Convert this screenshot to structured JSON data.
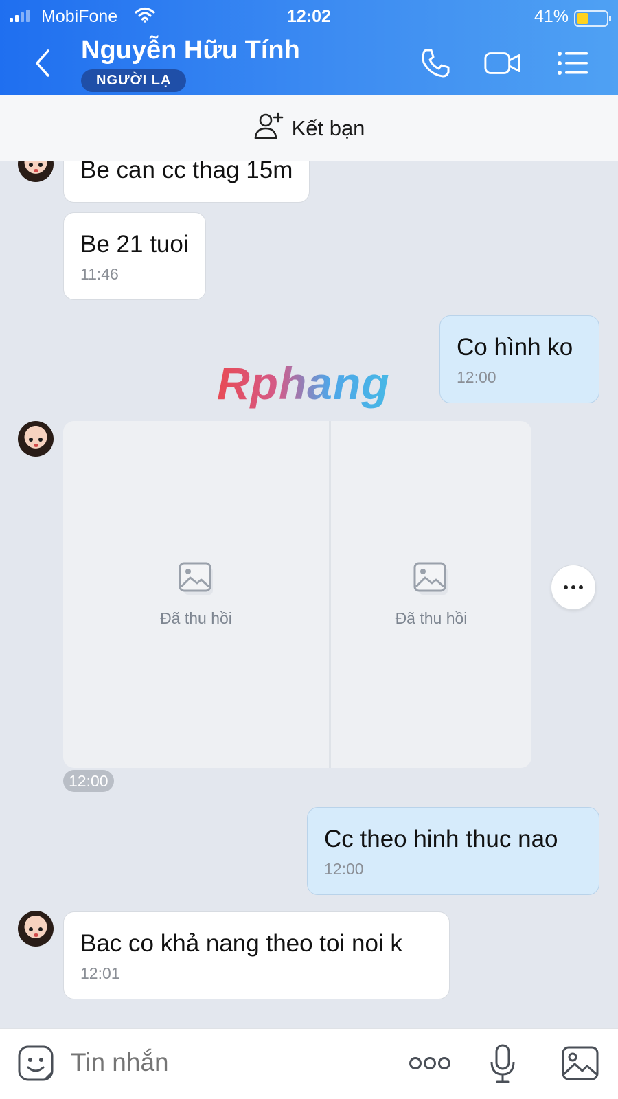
{
  "status_bar": {
    "carrier": "MobiFone",
    "time": "12:02",
    "battery_percent": "41%",
    "battery_level": 0.41,
    "battery_color": "#ffd21f"
  },
  "header": {
    "contact_name": "Nguyễn Hữu Tính",
    "badge": "NGƯỜI LẠ",
    "icons": [
      "back-arrow-icon",
      "phone-icon",
      "video-call-icon",
      "menu-list-icon"
    ],
    "gradient_start": "#1f6ff0",
    "gradient_end": "#4fa1f3"
  },
  "add_friend": {
    "label": "Kết bạn",
    "icon": "add-friend-icon"
  },
  "messages": [
    {
      "from": "them",
      "text": "Be can cc thag 15m",
      "time": ""
    },
    {
      "from": "them",
      "text": "Be 21 tuoi",
      "time": "11:46"
    },
    {
      "from": "me",
      "text": "Co hình ko",
      "time": "12:00"
    },
    {
      "from": "them",
      "type": "photos",
      "items": [
        {
          "label": "Đã thu hồi",
          "icon": "image-placeholder-icon"
        },
        {
          "label": "Đã thu hồi",
          "icon": "image-placeholder-icon"
        }
      ],
      "time": "12:00"
    },
    {
      "from": "me",
      "text": "Cc theo hinh thuc nao",
      "time": "12:00"
    },
    {
      "from": "them",
      "text": "Bac co khả nang theo toi noi k",
      "time": "12:01"
    }
  ],
  "watermark": "Rphang",
  "input_bar": {
    "placeholder": "Tin nhắn",
    "icons": [
      "sticker-icon",
      "more-options-icon",
      "microphone-icon",
      "gallery-icon"
    ]
  },
  "colors": {
    "chat_background": "#e3e7ee",
    "my_bubble": "#d6ebfb",
    "their_bubble": "#ffffff"
  }
}
